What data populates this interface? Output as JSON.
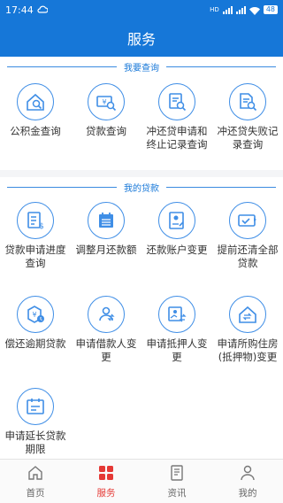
{
  "status": {
    "time": "17:44",
    "battery": "48"
  },
  "header": {
    "title": "服务"
  },
  "section1": {
    "title": "我要查询",
    "items": [
      {
        "label": "公积金查询",
        "icon": "house-search-icon"
      },
      {
        "label": "贷款查询",
        "icon": "money-search-icon"
      },
      {
        "label": "冲还贷申请和终止记录查询",
        "icon": "document-search-icon"
      },
      {
        "label": "冲还贷失败记录查询",
        "icon": "file-search-icon"
      }
    ]
  },
  "section2": {
    "title": "我的贷款",
    "items": [
      {
        "label": "贷款申请进度查询",
        "icon": "checklist-icon"
      },
      {
        "label": "调整月还款额",
        "icon": "calendar-icon"
      },
      {
        "label": "还款账户变更",
        "icon": "account-card-icon"
      },
      {
        "label": "提前还清全部贷款",
        "icon": "card-check-icon"
      },
      {
        "label": "偿还逾期贷款",
        "icon": "overdue-money-icon"
      },
      {
        "label": "申请借款人变更",
        "icon": "person-swap-icon"
      },
      {
        "label": "申请抵押人变更",
        "icon": "photo-swap-icon"
      },
      {
        "label": "申请所购住房(抵押物)变更",
        "icon": "house-swap-icon"
      },
      {
        "label": "申请延长贷款期限",
        "icon": "calendar-extend-icon"
      }
    ]
  },
  "tabs": [
    {
      "label": "首页",
      "icon": "home-icon"
    },
    {
      "label": "服务",
      "icon": "service-grid-icon"
    },
    {
      "label": "资讯",
      "icon": "news-icon"
    },
    {
      "label": "我的",
      "icon": "user-icon"
    }
  ],
  "colors": {
    "primary": "#1677d8",
    "icon_blue": "#3f8ee6",
    "active_tab": "#e53935"
  }
}
